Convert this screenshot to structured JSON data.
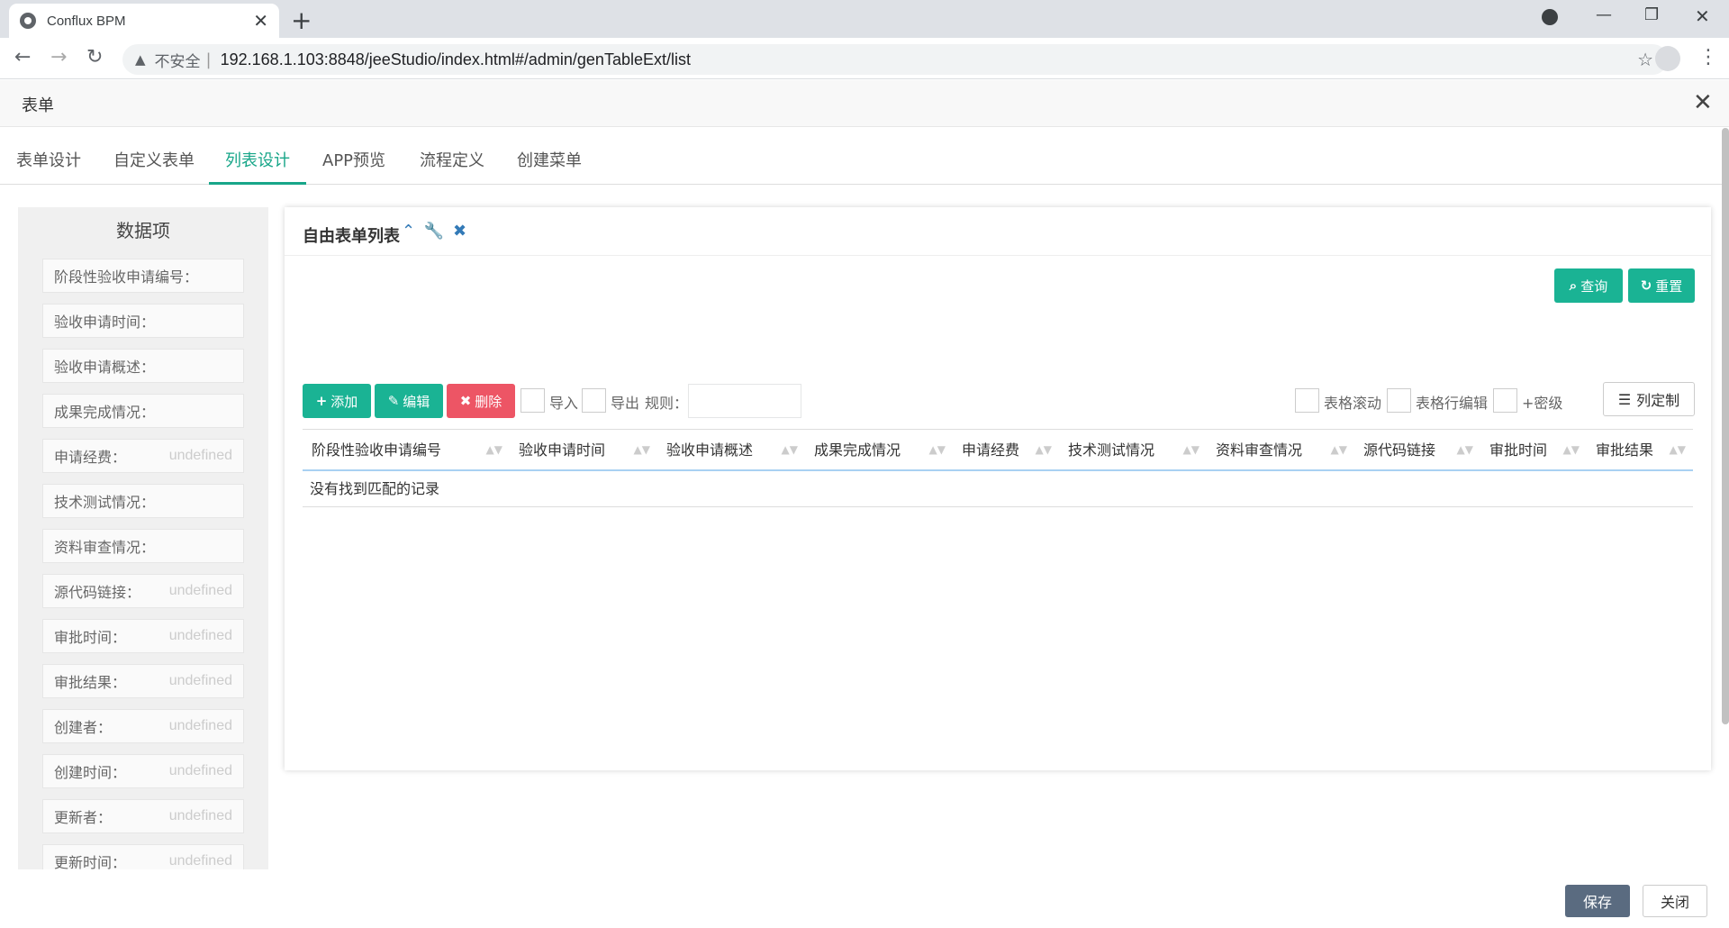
{
  "browser": {
    "tab_title": "Conflux BPM",
    "insecure_label": "不安全",
    "url": "192.168.1.103:8848/jeeStudio/index.html#/admin/genTableExt/list"
  },
  "app": {
    "header_title": "表单",
    "tabs": [
      "表单设计",
      "自定义表单",
      "列表设计",
      "APP预览",
      "流程定义",
      "创建菜单"
    ],
    "active_tab": "列表设计"
  },
  "data_panel": {
    "title": "数据项",
    "items": [
      {
        "label": "阶段性验收申请编号：",
        "value": ""
      },
      {
        "label": "验收申请时间：",
        "value": ""
      },
      {
        "label": "验收申请概述：",
        "value": ""
      },
      {
        "label": "成果完成情况：",
        "value": ""
      },
      {
        "label": "申请经费：",
        "value": "undefined"
      },
      {
        "label": "技术测试情况：",
        "value": ""
      },
      {
        "label": "资料审查情况：",
        "value": ""
      },
      {
        "label": "源代码链接：",
        "value": "undefined"
      },
      {
        "label": "审批时间：",
        "value": "undefined"
      },
      {
        "label": "审批结果：",
        "value": "undefined"
      },
      {
        "label": "创建者：",
        "value": "undefined"
      },
      {
        "label": "创建时间：",
        "value": "undefined"
      },
      {
        "label": "更新者：",
        "value": "undefined"
      },
      {
        "label": "更新时间：",
        "value": "undefined"
      }
    ]
  },
  "card": {
    "title": "自由表单列表",
    "search_label": "查询",
    "reset_label": "重置",
    "add_label": "添加",
    "edit_label": "编辑",
    "delete_label": "删除",
    "import_label": "导入",
    "export_label": "导出",
    "rule_label": "规则：",
    "scroll_label": "表格滚动",
    "row_edit_label": "表格行编辑",
    "secret_label": "+密级",
    "column_custom_label": "列定制",
    "columns": [
      "阶段性验收申请编号",
      "验收申请时间",
      "验收申请概述",
      "成果完成情况",
      "申请经费",
      "技术测试情况",
      "资料审查情况",
      "源代码链接",
      "审批时间",
      "审批结果"
    ],
    "empty_text": "没有找到匹配的记录"
  },
  "footer": {
    "save_label": "保存",
    "close_label": "关闭"
  }
}
